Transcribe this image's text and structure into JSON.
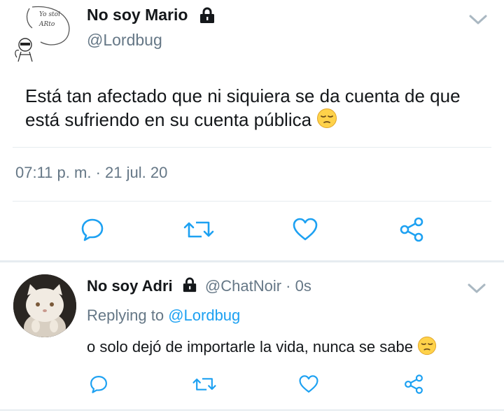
{
  "main_tweet": {
    "author_name": "No soy Mario",
    "author_handle": "@Lordbug",
    "avatar_caption": "Yo stoi ARto",
    "text": "Está tan afectado que ni siquiera se da cuenta de que está sufriendo en su cuenta pública",
    "emoji": "pensive-face",
    "time": "07:11 p. m.",
    "separator": "·",
    "date": "21 jul. 20",
    "actions": [
      "reply-icon",
      "retweet-icon",
      "like-icon",
      "share-icon"
    ]
  },
  "reply": {
    "author_name": "No soy Adri",
    "author_handle": "@ChatNoir",
    "separator": "·",
    "time": "0s",
    "replying_label": "Replying to",
    "replying_to": "@Lordbug",
    "text": "o solo dejó de importarle la vida, nunca se sabe",
    "emoji": "pensive-face",
    "actions": [
      "reply-icon",
      "retweet-icon",
      "like-icon",
      "share-icon"
    ]
  },
  "colors": {
    "text": "#14171a",
    "muted": "#657786",
    "accent": "#1da1f2",
    "divider": "#e6ecf0",
    "action_icon": "#1da1f2"
  }
}
